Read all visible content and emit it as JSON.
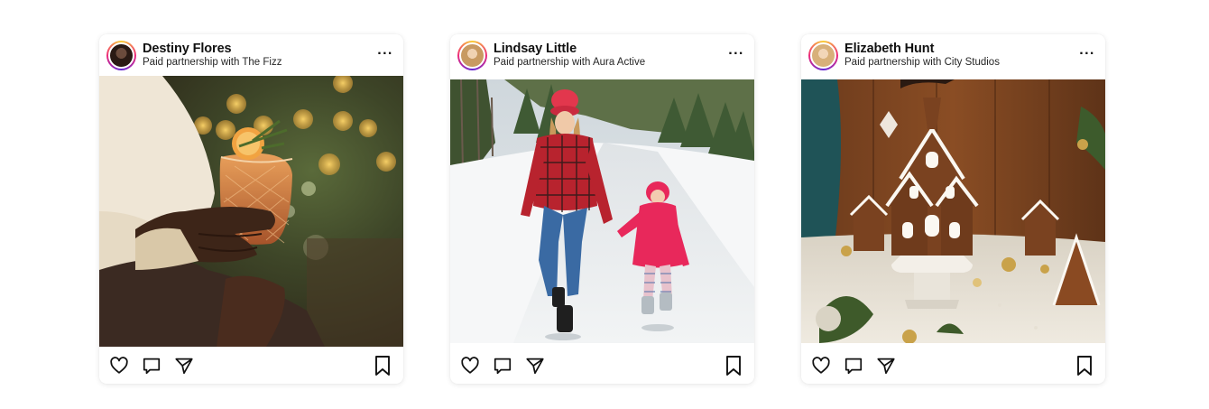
{
  "posts": [
    {
      "username": "Destiny Flores",
      "partnership": "Paid partnership with The Fizz",
      "more_label": "···",
      "photo_subject": "Hand holding an orange cocktail with rosemary in front of christmas lights",
      "avatar_color": "#3a2a22"
    },
    {
      "username": "Lindsay Little",
      "partnership": "Paid partnership with Aura Active",
      "more_label": "···",
      "photo_subject": "Woman and child in winter clothes walking on a snowy road",
      "avatar_color": "#d9b48a"
    },
    {
      "username": "Elizabeth Hunt",
      "partnership": "Paid partnership with City Studios",
      "more_label": "···",
      "photo_subject": "Gingerbread houses on a cake stand with holiday decor",
      "avatar_color": "#e8c79a"
    }
  ],
  "icons": {
    "like": "heart-icon",
    "comment": "comment-icon",
    "share": "send-icon",
    "save": "bookmark-icon"
  }
}
